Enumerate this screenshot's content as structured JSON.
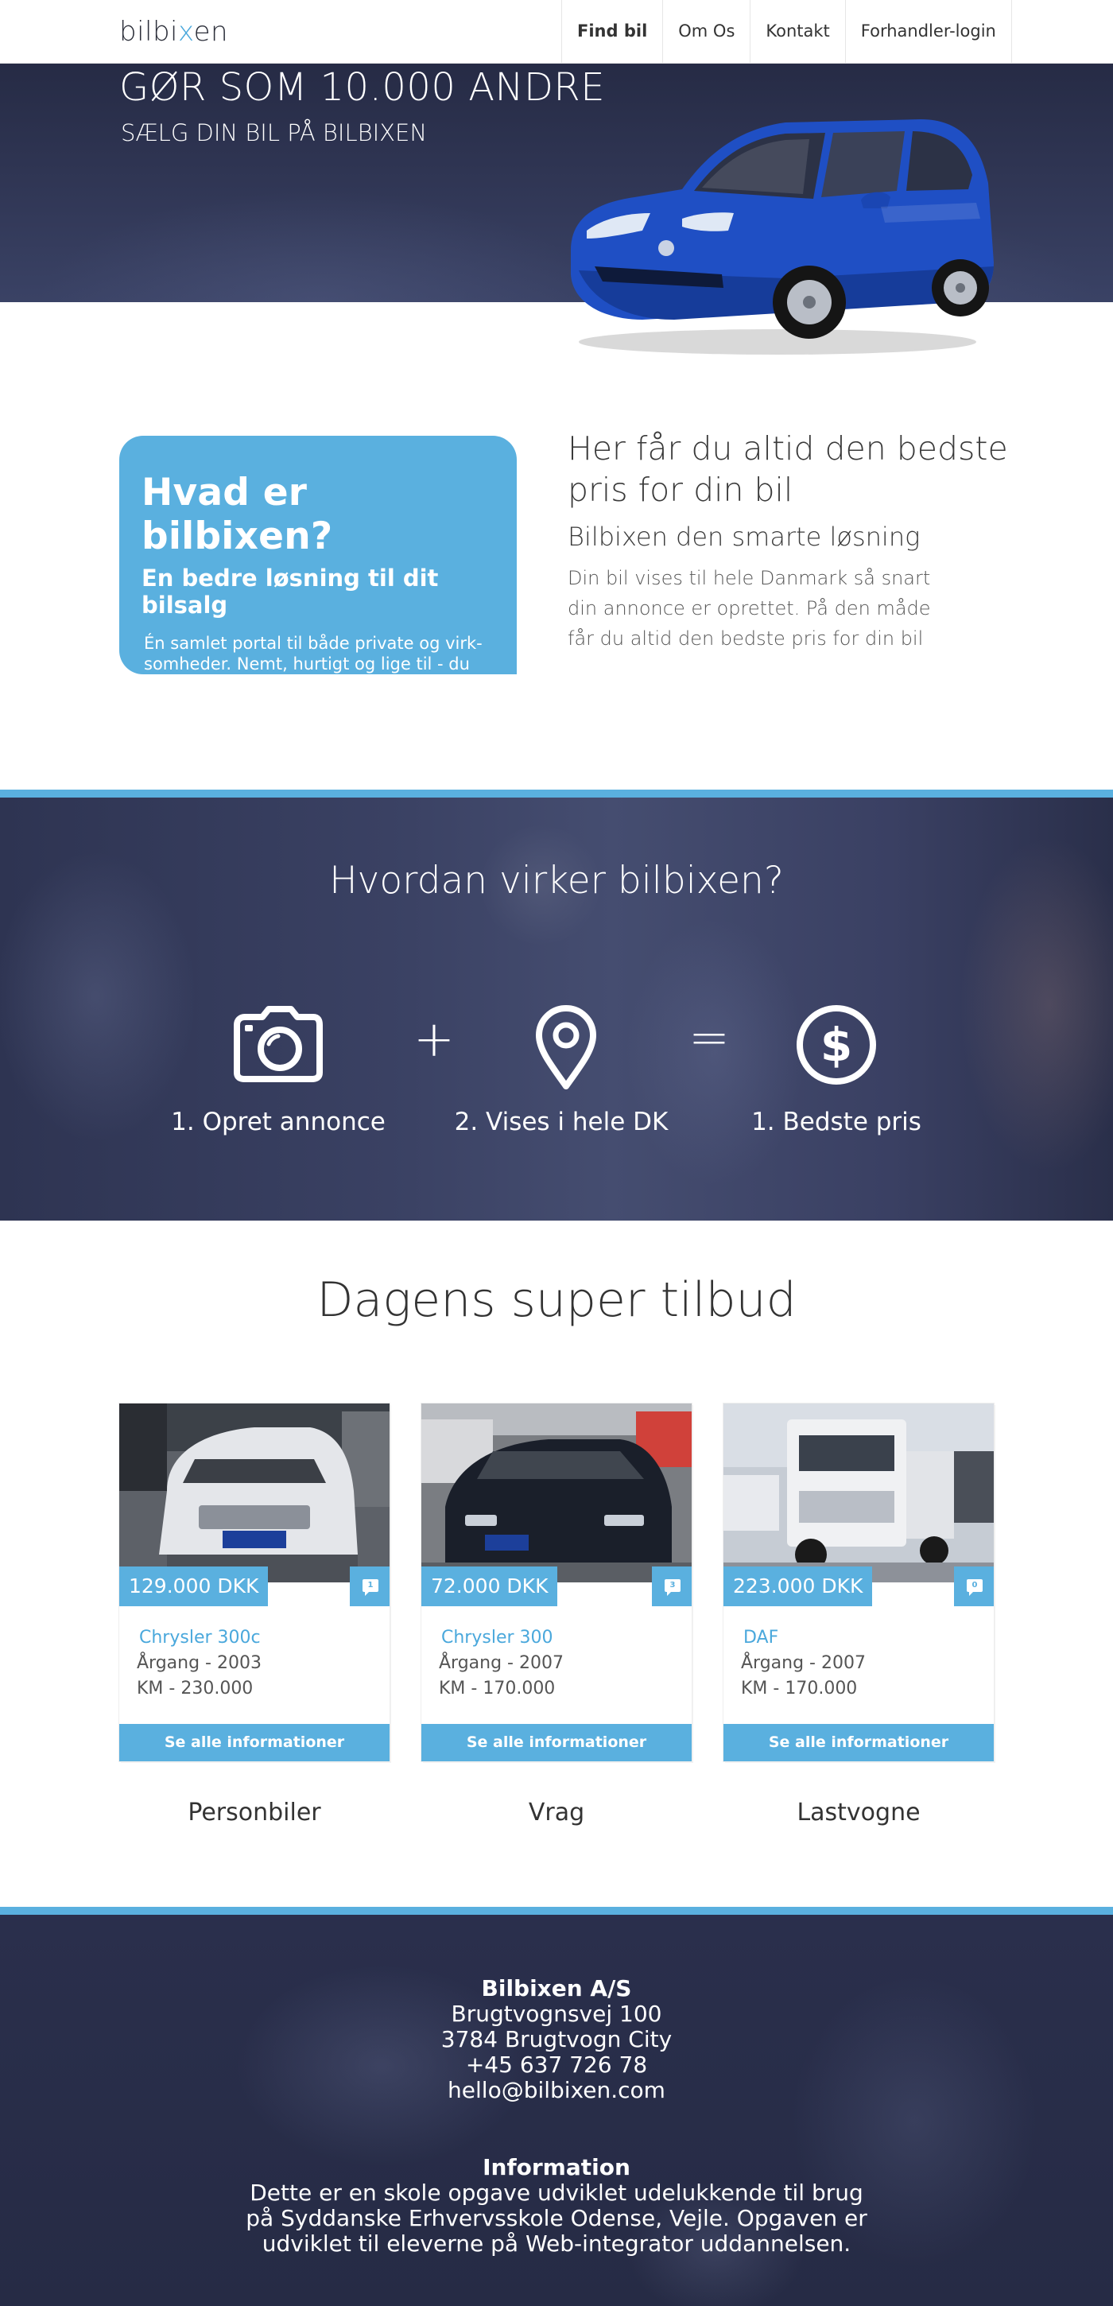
{
  "nav": {
    "logo_pre": "bilbi",
    "logo_x": "x",
    "logo_post": "en",
    "links": [
      "Find bil",
      "Om Os",
      "Kontakt",
      "Forhandler-login"
    ]
  },
  "hero": {
    "title": "GØR SOM 10.000 ANDRE",
    "subtitle": "SÆLG DIN BIL PÅ BILBIXEN"
  },
  "intro": {
    "box_title": "Hvad er bilbixen?",
    "box_subtitle": "En bedre løsning til dit bilsalg",
    "box_text": "Én samlet portal til både private og virk-somheder. Nemt, hurtigt og lige til - du opnår altid den højeste pris på markedet.",
    "heading": "Her får du altid den bedste pris for din bil",
    "subheading": "Bilbixen den smarte løsning",
    "text": "Din bil vises til hele Danmark så snart din annonce er oprettet. På den måde får du altid den bedste pris for din bil"
  },
  "how": {
    "title": "Hvordan virker bilbixen?",
    "steps": [
      {
        "label": "1. Opret annonce",
        "icon": "camera-icon"
      },
      {
        "label": "2. Vises i hele DK",
        "icon": "location-pin-icon"
      },
      {
        "label": "1. Bedste pris",
        "icon": "dollar-icon"
      }
    ],
    "plus": "+",
    "equals": "="
  },
  "offers": {
    "title": "Dagens super tilbud",
    "button_label": "Se alle informationer",
    "cards": [
      {
        "price": "129.000 DKK",
        "comments": "1",
        "name": "Chrysler 300c",
        "year": "Årgang - 2003",
        "km": "KM - 230.000",
        "category": "Personbiler"
      },
      {
        "price": "72.000 DKK",
        "comments": "3",
        "name": "Chrysler 300",
        "year": "Årgang - 2007",
        "km": "KM - 170.000",
        "category": "Vrag"
      },
      {
        "price": "223.000 DKK",
        "comments": "0",
        "name": "DAF",
        "year": "Årgang - 2007",
        "km": "KM - 170.000",
        "category": "Lastvogne"
      }
    ]
  },
  "footer": {
    "company": "Bilbixen A/S",
    "address": "Brugtvognsvej 100",
    "city": "3784 Brugtvogn City",
    "phone": "+45 637 726 78",
    "email": "hello@bilbixen.com",
    "info_title": "Information",
    "info_lines": [
      "Dette er en skole opgave udviklet udelukkende til brug",
      "på Syddanske Erhvervsskole Odense, Vejle. Opgaven er",
      "udviklet til eleverne på Web-integrator uddannelsen."
    ]
  },
  "colors": {
    "accent": "#5ab0df",
    "dark": "#262b45",
    "car_blue": "#1f4fc4"
  }
}
